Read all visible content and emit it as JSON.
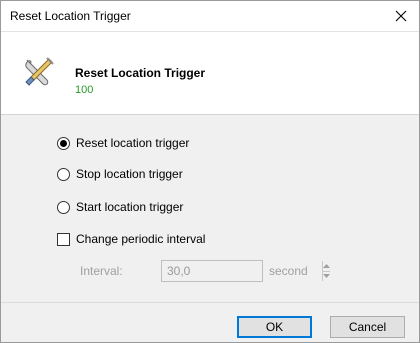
{
  "window": {
    "title": "Reset Location Trigger",
    "close_icon": "close-icon"
  },
  "header": {
    "icon": "tools-icon",
    "title": "Reset Location Trigger",
    "subtitle": "100",
    "subtitle_color": "#2b9a2b"
  },
  "options": {
    "reset_label": "Reset location trigger",
    "stop_label": "Stop location trigger",
    "start_label": "Start location trigger",
    "selected": "reset",
    "periodic_label": "Change periodic interval",
    "periodic_checked": false
  },
  "interval": {
    "label": "Interval:",
    "value": "30,0",
    "unit": "second",
    "enabled": false
  },
  "buttons": {
    "ok_label": "OK",
    "cancel_label": "Cancel"
  },
  "colors": {
    "accent": "#0078d7",
    "body_bg": "#f0f0f0"
  }
}
